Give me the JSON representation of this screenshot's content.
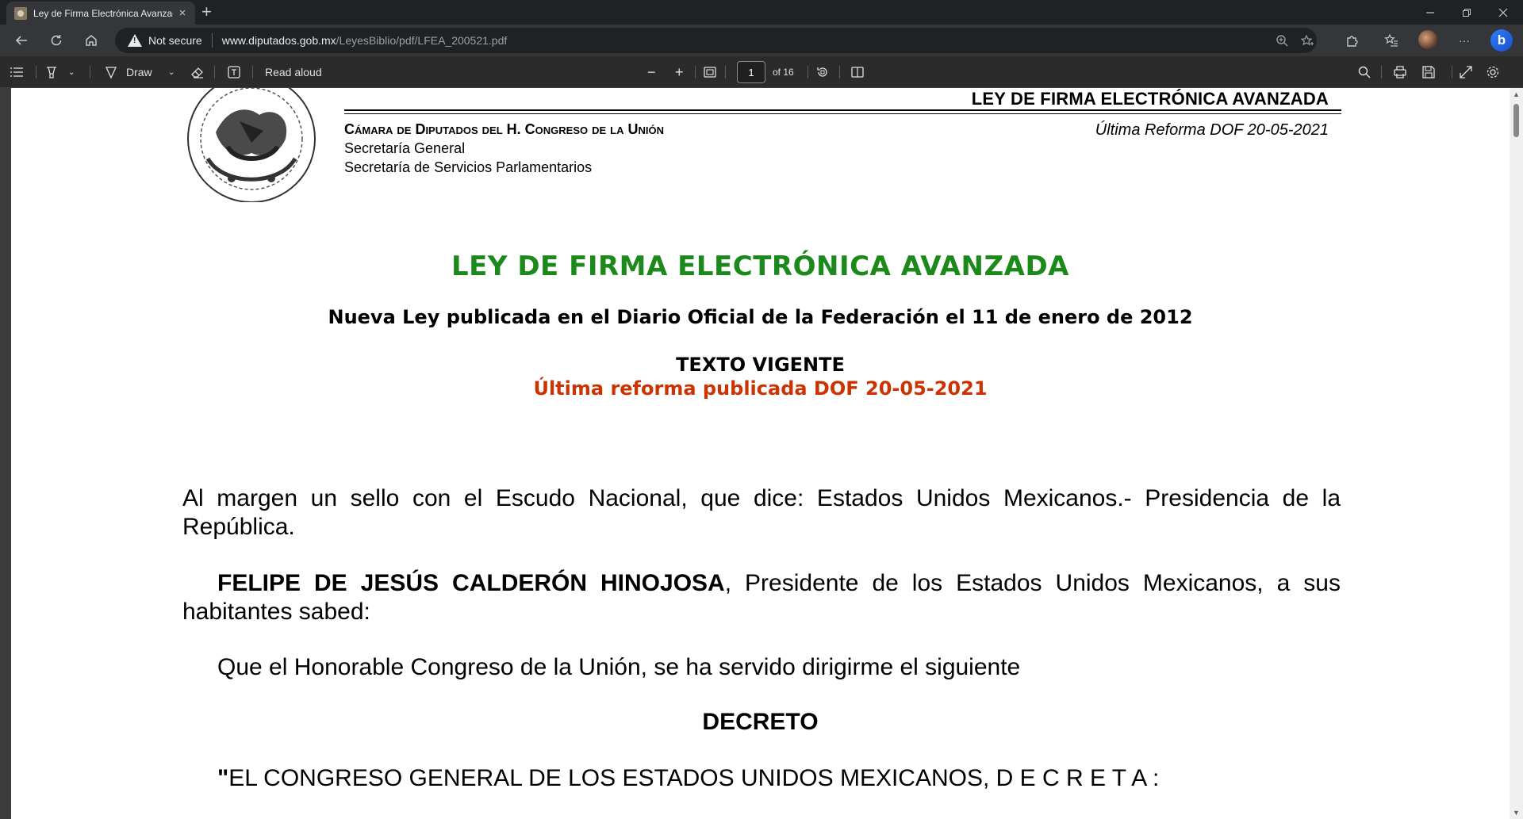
{
  "browser": {
    "tab_title": "Ley de Firma Electrónica Avanzada",
    "new_tab_symbol": "+",
    "close_symbol": "×",
    "security_label": "Not secure",
    "url_host": "www.diputados.gob.mx",
    "url_path": "/LeyesBiblio/pdf/LFEA_200521.pdf",
    "more_symbol": "···"
  },
  "pdf_toolbar": {
    "draw_label": "Draw",
    "read_aloud_label": "Read aloud",
    "page_current": "1",
    "page_total_label": "of 16",
    "zoom_out_symbol": "−",
    "zoom_in_symbol": "+"
  },
  "document": {
    "header_title": "LEY DE FIRMA ELECTRÓNICA AVANZADA",
    "camara": "Cámara de Diputados del H. Congreso de la Unión",
    "secretaria_general": "Secretaría General",
    "secretaria_servicios": "Secretaría de Servicios Parlamentarios",
    "ultima_reforma_header": "Última Reforma DOF 20-05-2021",
    "main_title": "LEY DE FIRMA ELECTRÓNICA AVANZADA",
    "nueva_ley": "Nueva Ley publicada en el Diario Oficial de la Federación el 11 de enero de 2012",
    "texto_vigente": "TEXTO VIGENTE",
    "ultima_reforma": "Última reforma publicada DOF 20-05-2021",
    "margen_paragraph": "Al margen un sello con el Escudo Nacional, que dice: Estados Unidos Mexicanos.- Presidencia de la República.",
    "president_name": "FELIPE DE JESÚS CALDERÓN HINOJOSA",
    "president_rest": ", Presidente de los Estados Unidos Mexicanos, a sus habitantes sabed:",
    "congreso_paragraph": "Que el Honorable Congreso de la Unión, se ha servido dirigirme el siguiente",
    "decreto": "DECRETO",
    "quote_mark": "\"",
    "congreso_general": "EL CONGRESO GENERAL DE LOS ESTADOS UNIDOS MEXICANOS, D E C R E T A :"
  },
  "colors": {
    "title_green": "#1b8a1b",
    "reforma_red": "#cc3300",
    "browser_dark": "#202124",
    "toolbar_dark": "#2b2b2b"
  }
}
